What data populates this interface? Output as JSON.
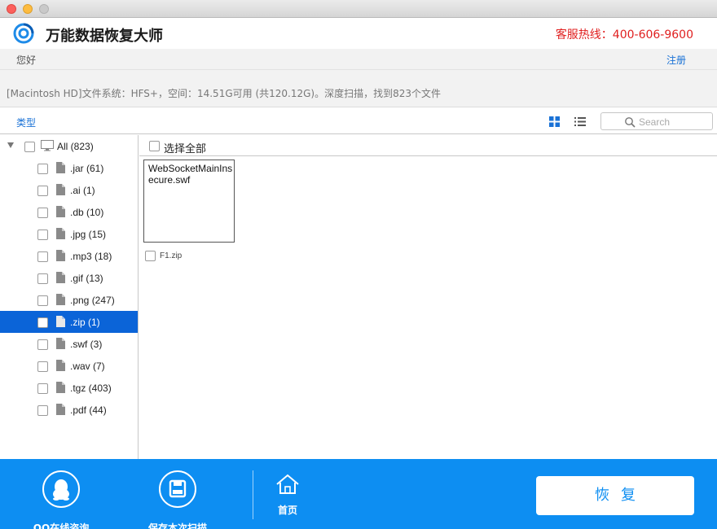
{
  "app": {
    "title": "万能数据恢复大师",
    "hotline": "客服热线：400-606-9600",
    "greeting": "您好",
    "register": "注册"
  },
  "scan": {
    "info": "[Macintosh HD]文件系统：HFS+，空间：14.51G可用 (共120.12G)。深度扫描，找到823个文件"
  },
  "toolbar": {
    "type_tab": "类型",
    "search_placeholder": "Search"
  },
  "tree": {
    "root": {
      "label": "All (823)"
    },
    "items": [
      {
        "label": ".jar (61)",
        "selected": false
      },
      {
        "label": ".ai (1)",
        "selected": false
      },
      {
        "label": ".db (10)",
        "selected": false
      },
      {
        "label": ".jpg (15)",
        "selected": false
      },
      {
        "label": ".mp3 (18)",
        "selected": false
      },
      {
        "label": ".gif (13)",
        "selected": false
      },
      {
        "label": ".png (247)",
        "selected": false
      },
      {
        "label": ".zip (1)",
        "selected": true
      },
      {
        "label": ".swf (3)",
        "selected": false
      },
      {
        "label": ".wav (7)",
        "selected": false
      },
      {
        "label": ".tgz (403)",
        "selected": false
      },
      {
        "label": ".pdf (44)",
        "selected": false
      }
    ]
  },
  "content": {
    "select_all": "选择全部",
    "tile_text": "WebSocketMainInsecure.swf",
    "file_name": "F1.zip"
  },
  "bottom": {
    "qq": "QQ在线咨询",
    "save_scan": "保存本次扫描",
    "home": "首页",
    "recover": "恢复"
  },
  "colors": {
    "accent": "#0d8ef2",
    "selection": "#0b64d8",
    "hotline": "#e02020",
    "link": "#1a72d6"
  }
}
